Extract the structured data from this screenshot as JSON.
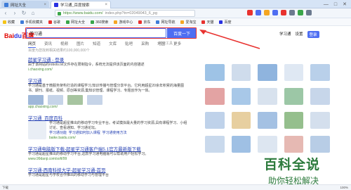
{
  "browser": {
    "tabs": [
      {
        "label": "网址大全",
        "active": false
      },
      {
        "label": "学习通_百度搜索",
        "active": true
      }
    ],
    "window_controls": [
      "—",
      "□",
      "✕"
    ],
    "url_host": "https://www.baidu.com/",
    "url_path": "index.php?tn=02049043_6_pg",
    "bookmarks": [
      "收藏",
      "手机收藏夹",
      "谷歌",
      "网址大全",
      "360搜索",
      "游戏中心",
      "京东",
      "网址导航",
      "爱淘宝",
      "天猫",
      "百度"
    ]
  },
  "header": {
    "logo_text_red": "Bai",
    "logo_text_blue": "du",
    "logo_suffix": "百度",
    "search_value": "学习通",
    "search_button": "百度一下",
    "right_links": [
      "学习通",
      "设置",
      "登录"
    ]
  },
  "tabs": {
    "items": [
      "网页",
      "资讯",
      "视频",
      "图片",
      "知道",
      "文库",
      "贴吧",
      "采购",
      "地图",
      "更多"
    ],
    "tools": "搜索工具"
  },
  "count_text": "百度为您找到相关结果约100,000,000个",
  "results": [
    {
      "title": "超星学习通 - 登录",
      "snippet": "由于该网站的robots.txt文件存在限制指令，系统无法提供该页面的内容描述",
      "url": "i.chaoxing.com/"
    },
    {
      "title": "学习通",
      "snippet": "学习通是基于微服务架构打造的课程学习,知识传播与管理分享平台。它利用超星20余年积累的海量图书、期刊、报纸、视频、原创等资源,集知识管理、课程学习、专题创作为一体。",
      "url": "app.chaoxing.com/"
    },
    {
      "title": "学习通_百度百科",
      "snippet": "学习通是超星推出的移动学习专业平台。考试模拟最大量的学习资源,具有课程学习、小组讨论、查看通知、学习通论坛。",
      "url": "baike.baidu.com/"
    },
    {
      "title": "学习通电脑版下载-超星学习通客户端5.1官方最新版下载",
      "snippet": "学习通是超星推出的移动学习平台,这款学习通电脑版可以帮助用户轻松学习。",
      "url": "www.99danji.com/soft/99"
    },
    {
      "title": "学习通-西南科技大学-超星学习通-首页",
      "snippet": "学习通是超星与学校合作推出的移动学习与管理平台",
      "url": ""
    }
  ],
  "baike_sublinks": [
    "学习通功能",
    "学习通如何加入课程",
    "学习通使用方法"
  ],
  "watermark": {
    "line1": "百科全说",
    "line2": "助你轻松解决"
  },
  "status": [
    "下载",
    "100%"
  ],
  "colors": {
    "accent": "#4e6ef2",
    "link": "#2440b3",
    "highlight": "#e8322f",
    "watermark": "#2c7a3c"
  }
}
